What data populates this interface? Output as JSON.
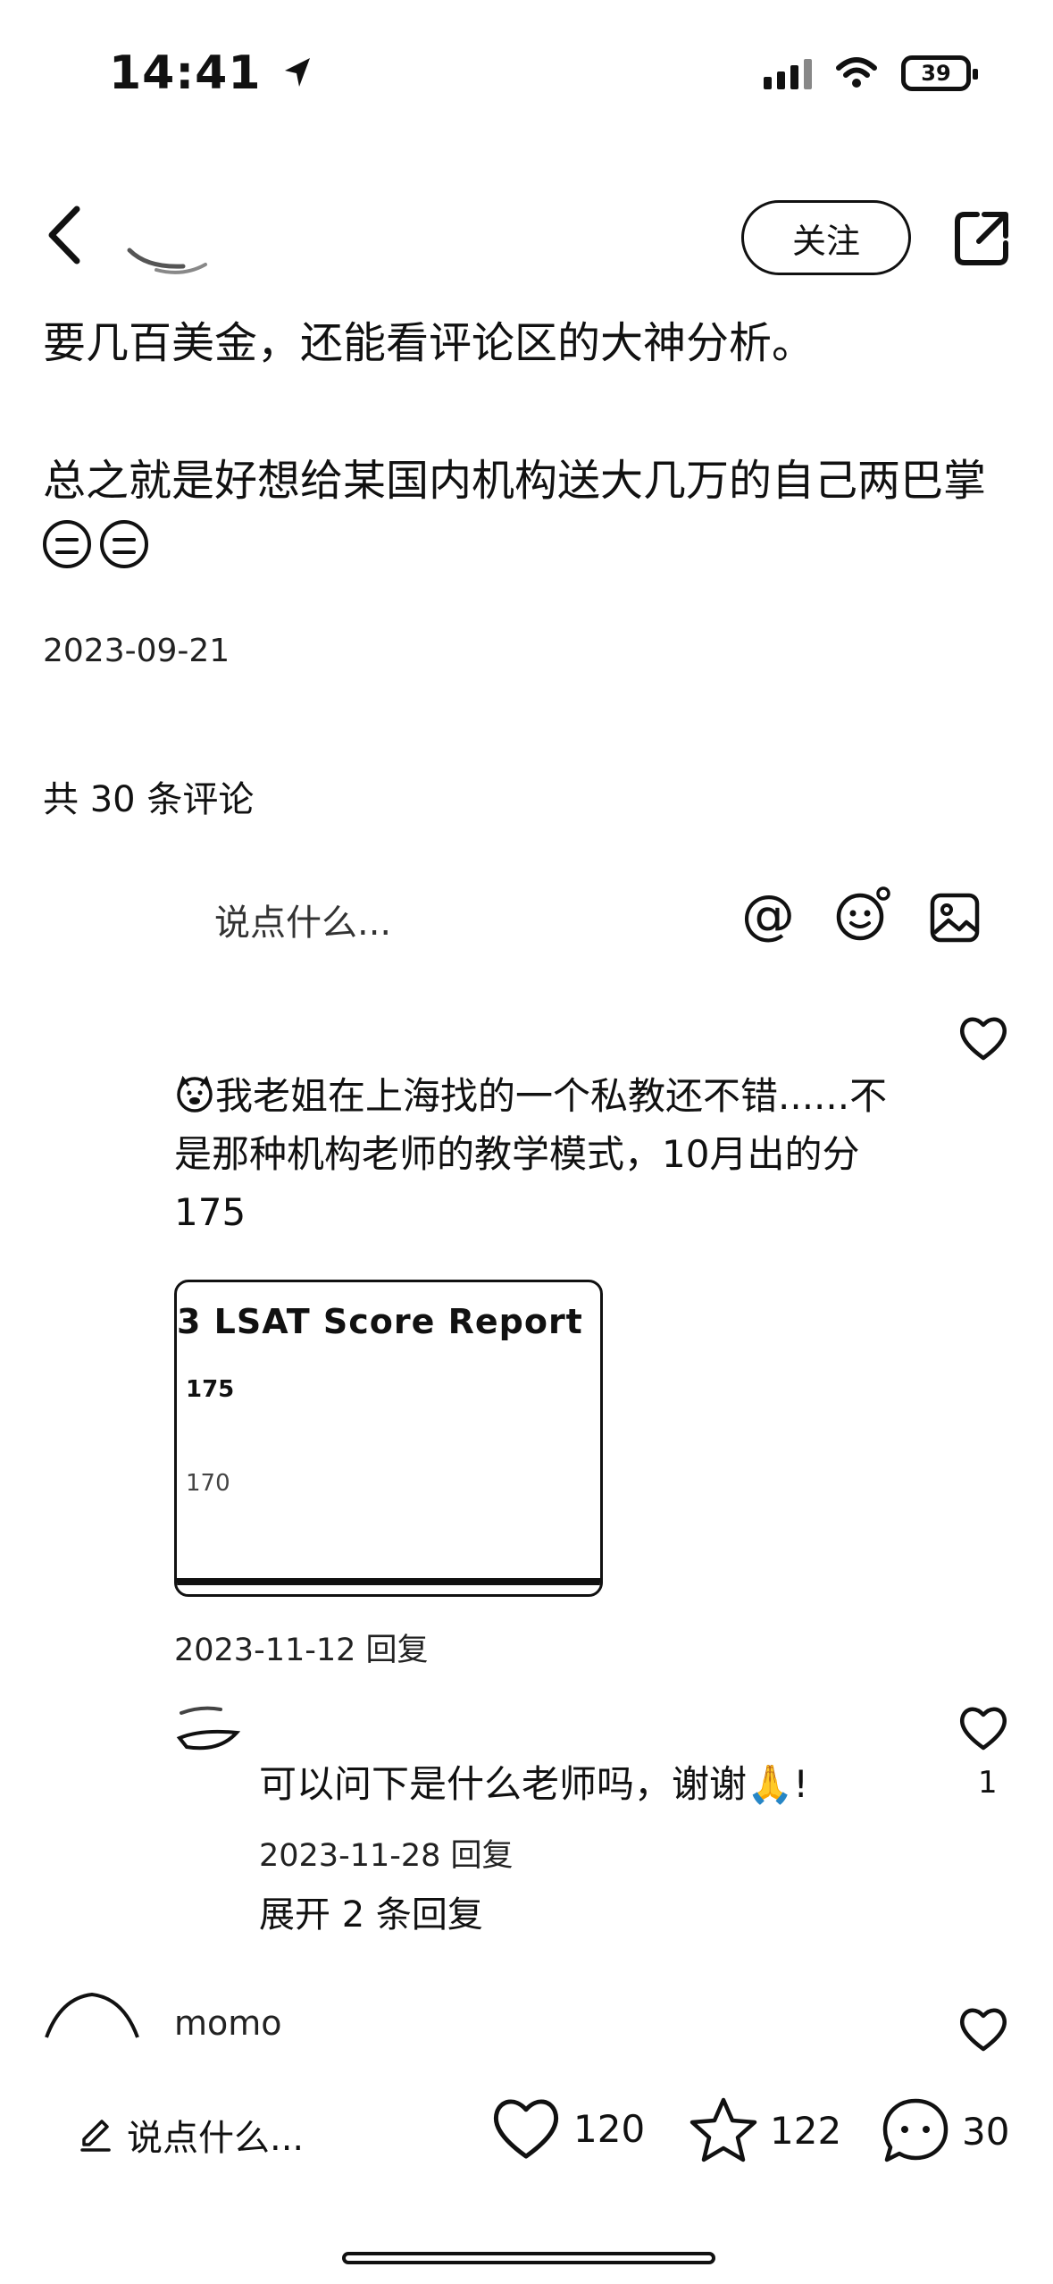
{
  "status_bar": {
    "time": "14:41",
    "battery": "39"
  },
  "header": {
    "follow_label": "关注"
  },
  "post": {
    "line1": "要几百美金，还能看评论区的大神分析。",
    "line2": "总之就是好想给某国内机构送大几万的自己两巴掌",
    "date": "2023-09-21"
  },
  "comments_section": {
    "count_label": "共 30 条评论",
    "input_placeholder": "说点什么..."
  },
  "comments": [
    {
      "line1": "我老姐在上海找的一个私教还不错......不",
      "line2": "是那种机构老师的教学模式，10月出的分",
      "line3": "175",
      "image": {
        "title": "3 LSAT Score Report",
        "score1": "175",
        "score2": "170"
      },
      "meta": "2023-11-12 回复"
    }
  ],
  "reply": {
    "text": "可以问下是什么老师吗，谢谢🙏!",
    "meta": "2023-11-28 回复",
    "like_count": "1",
    "expand_label": "展开 2 条回复"
  },
  "next_comment": {
    "author": "momo"
  },
  "bottom_bar": {
    "input_placeholder": "说点什么...",
    "likes": "120",
    "stars": "122",
    "comments": "30"
  }
}
